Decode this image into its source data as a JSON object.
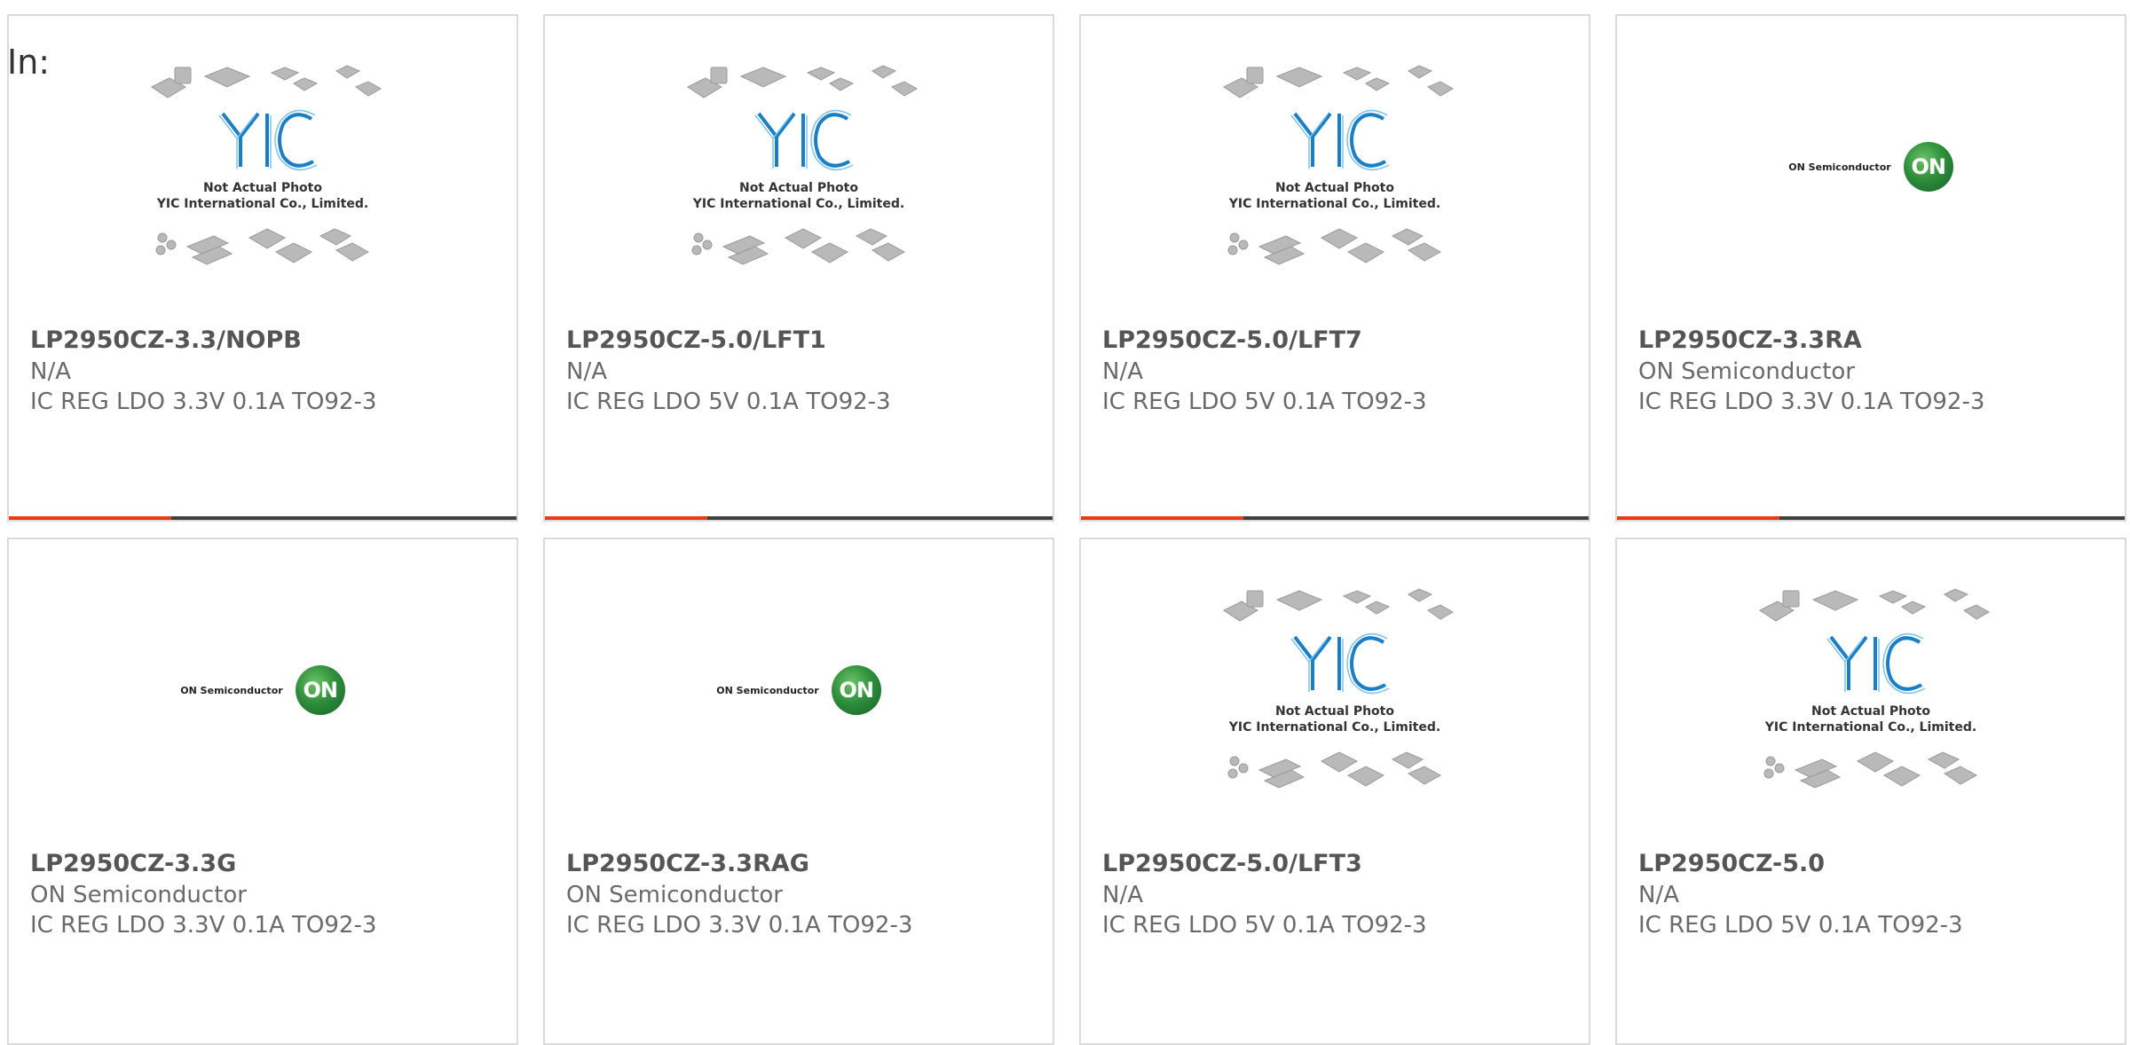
{
  "header": {
    "in_label": "In:"
  },
  "placeholder": {
    "logo_text": "YIC",
    "caption_line1": "Not Actual Photo",
    "caption_line2": "YIC International Co., Limited."
  },
  "on_logo": {
    "text": "ON Semiconductor",
    "mark": "ON"
  },
  "colors": {
    "accent": "#ea3a12",
    "bar": "#3f3f3f",
    "border": "#dadada",
    "on_green": "#2f8f3a",
    "yic_blue": "#1a7fc4"
  },
  "products": [
    {
      "part": "LP2950CZ-3.3/NOPB",
      "maker": "N/A",
      "desc": "IC REG LDO 3.3V 0.1A TO92-3",
      "image": "placeholder",
      "progress": 0.32
    },
    {
      "part": "LP2950CZ-5.0/LFT1",
      "maker": "N/A",
      "desc": "IC REG LDO 5V 0.1A TO92-3",
      "image": "placeholder",
      "progress": 0.32
    },
    {
      "part": "LP2950CZ-5.0/LFT7",
      "maker": "N/A",
      "desc": "IC REG LDO 5V 0.1A TO92-3",
      "image": "placeholder",
      "progress": 0.32
    },
    {
      "part": "LP2950CZ-3.3RA",
      "maker": "ON Semiconductor",
      "desc": "IC REG LDO 3.3V 0.1A TO92-3",
      "image": "on",
      "progress": 0.32
    },
    {
      "part": "LP2950CZ-3.3G",
      "maker": "ON Semiconductor",
      "desc": "IC REG LDO 3.3V 0.1A TO92-3",
      "image": "on",
      "progress": null
    },
    {
      "part": "LP2950CZ-3.3RAG",
      "maker": "ON Semiconductor",
      "desc": "IC REG LDO 3.3V 0.1A TO92-3",
      "image": "on",
      "progress": null
    },
    {
      "part": "LP2950CZ-5.0/LFT3",
      "maker": "N/A",
      "desc": "IC REG LDO 5V 0.1A TO92-3",
      "image": "placeholder",
      "progress": null
    },
    {
      "part": "LP2950CZ-5.0",
      "maker": "N/A",
      "desc": "IC REG LDO 5V 0.1A TO92-3",
      "image": "placeholder",
      "progress": null
    }
  ]
}
